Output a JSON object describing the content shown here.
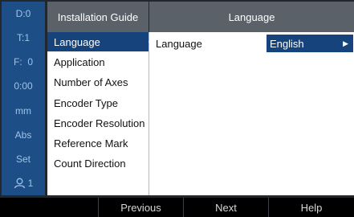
{
  "status_bar": {
    "datum": "D:0",
    "tool": "T:1",
    "feed": "F:  0",
    "time": "0:00",
    "unit": "mm",
    "mode": "Abs",
    "set": "Set",
    "user_count": "1",
    "user_icon": "user-icon"
  },
  "guide": {
    "title": "Installation Guide",
    "items": [
      {
        "label": "Language"
      },
      {
        "label": "Application"
      },
      {
        "label": "Number of Axes"
      },
      {
        "label": "Encoder Type"
      },
      {
        "label": "Encoder Resolution"
      },
      {
        "label": "Reference Mark"
      },
      {
        "label": "Count Direction"
      }
    ],
    "selected": "Language"
  },
  "content": {
    "title": "Language",
    "language_label": "Language",
    "language_value": "English"
  },
  "softkeys": {
    "previous": "Previous",
    "next": "Next",
    "help": "Help"
  }
}
